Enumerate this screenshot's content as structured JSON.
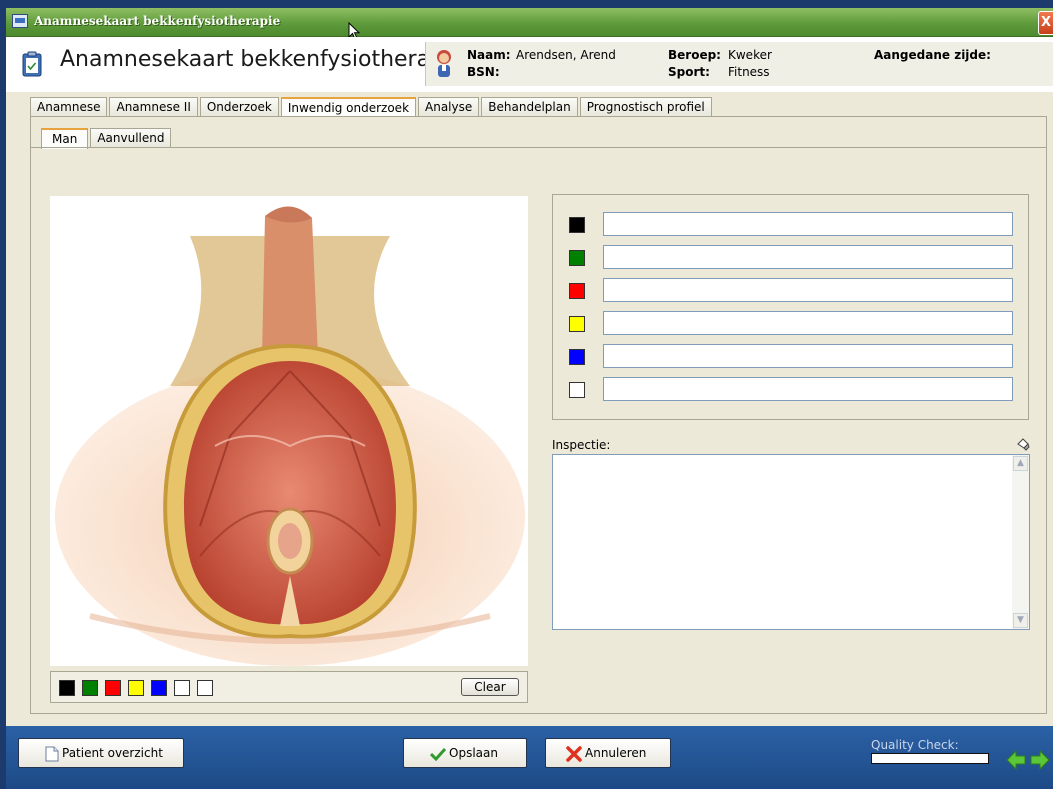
{
  "window": {
    "title": "Anamnesekaart bekkenfysiotherapie",
    "close_glyph": "X"
  },
  "header": {
    "title": "Anamnesekaart bekkenfysiotherapie"
  },
  "patient": {
    "naam_label": "Naam:",
    "naam_value": "Arendsen, Arend",
    "bsn_label": "BSN:",
    "bsn_value": "",
    "beroep_label": "Beroep:",
    "beroep_value": "Kweker",
    "sport_label": "Sport:",
    "sport_value": "Fitness",
    "zijde_label": "Aangedane zijde:",
    "zijde_value": ""
  },
  "tabs": [
    {
      "label": "Anamnese"
    },
    {
      "label": "Anamnese II"
    },
    {
      "label": "Onderzoek"
    },
    {
      "label": "Inwendig onderzoek",
      "active": true
    },
    {
      "label": "Analyse"
    },
    {
      "label": "Behandelplan"
    },
    {
      "label": "Prognostisch profiel"
    }
  ],
  "subtabs": [
    {
      "label": "Man",
      "active": true
    },
    {
      "label": "Aanvullend"
    }
  ],
  "palette": {
    "colors": [
      "#000000",
      "#008000",
      "#ff0000",
      "#ffff00",
      "#0000ff",
      "#ffffff",
      "#ffffff"
    ],
    "clear_label": "Clear"
  },
  "legend": [
    {
      "color": "#000000",
      "value": ""
    },
    {
      "color": "#008000",
      "value": ""
    },
    {
      "color": "#ff0000",
      "value": ""
    },
    {
      "color": "#ffff00",
      "value": ""
    },
    {
      "color": "#0000ff",
      "value": ""
    },
    {
      "color": "#ffffff",
      "value": ""
    }
  ],
  "inspectie": {
    "label": "Inspectie:",
    "value": ""
  },
  "footer": {
    "patient_overview_label": "Patient overzicht",
    "save_label": "Opslaan",
    "cancel_label": "Annuleren",
    "quality_check_label": "Quality Check:",
    "quality_check_progress": 0
  },
  "colors": {
    "footer_bg": "#1d4a86",
    "titlebar_bg": "#5f9b3b",
    "active_tab_accent": "#e7a33e"
  }
}
